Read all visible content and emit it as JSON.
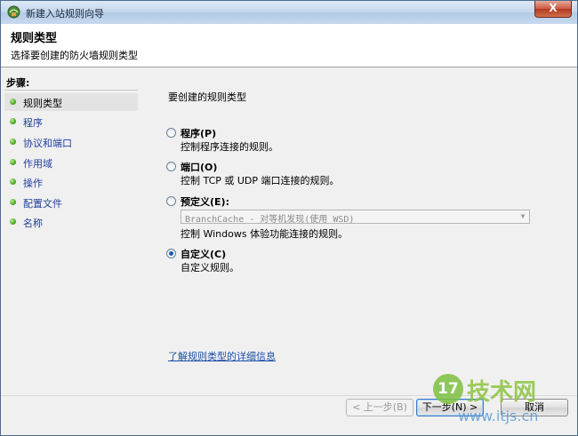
{
  "window": {
    "title": "新建入站规则向导",
    "close_label": "X"
  },
  "header": {
    "title": "规则类型",
    "subtitle": "选择要创建的防火墙规则类型"
  },
  "sidebar": {
    "label": "步骤:",
    "items": [
      {
        "label": "规则类型",
        "active": true
      },
      {
        "label": "程序"
      },
      {
        "label": "协议和端口"
      },
      {
        "label": "作用域"
      },
      {
        "label": "操作"
      },
      {
        "label": "配置文件"
      },
      {
        "label": "名称"
      }
    ]
  },
  "main": {
    "prompt": "要创建的规则类型",
    "options": [
      {
        "label": "程序(P)",
        "desc": "控制程序连接的规则。",
        "selected": false
      },
      {
        "label": "端口(O)",
        "desc": "控制 TCP 或 UDP 端口连接的规则。",
        "selected": false
      },
      {
        "label": "预定义(E):",
        "desc": "控制 Windows 体验功能连接的规则。",
        "selected": false
      },
      {
        "label": "自定义(C)",
        "desc": "自定义规则。",
        "selected": true
      }
    ],
    "predefined_select_value": "BranchCache - 对等机发现(使用 WSD)",
    "link": "了解规则类型的详细信息"
  },
  "buttons": {
    "back": "< 上一步(B)",
    "next": "下一步(N) >",
    "cancel": "取消"
  },
  "watermark": {
    "logo_number": "17",
    "brand": "技术网",
    "url": "www.itjs.cn"
  },
  "colors": {
    "link": "#1c4fa8",
    "step_dot": "#3a9c16",
    "radio_fill": "#1c5fb5"
  }
}
